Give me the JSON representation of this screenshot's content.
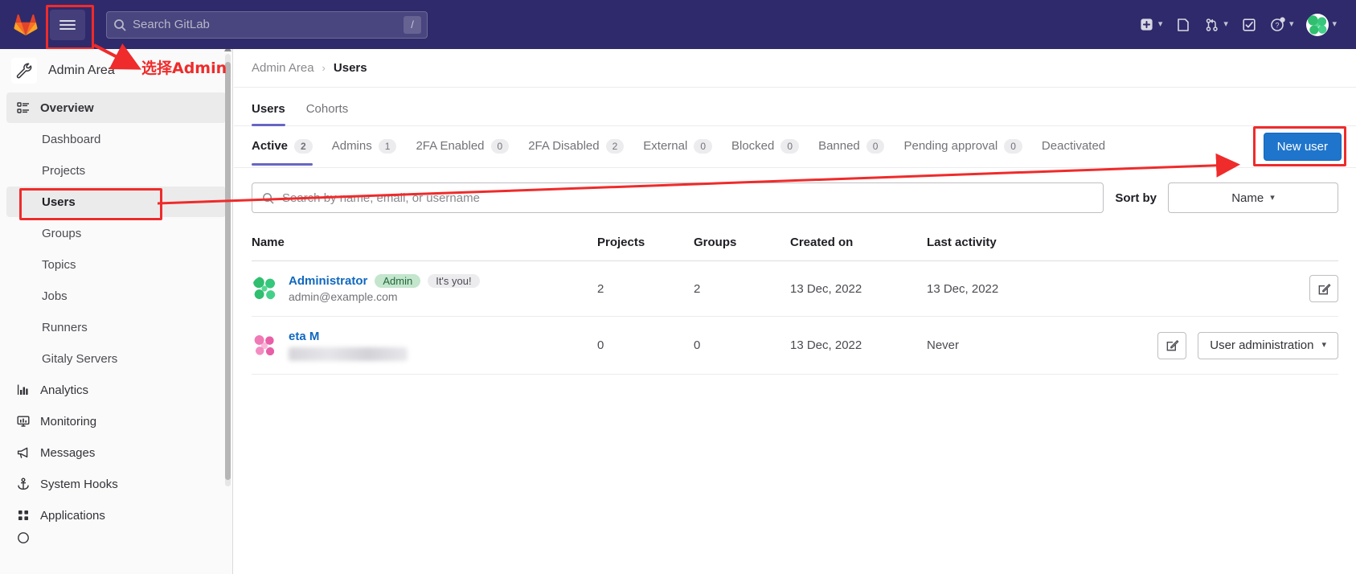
{
  "topnav": {
    "logo_icon": "gitlab-logo-icon",
    "hamburger_icon": "hamburger-menu-icon",
    "search": {
      "placeholder": "Search GitLab",
      "value": "",
      "shortcut_key": "/",
      "icon": "search-icon"
    },
    "items": [
      {
        "name": "create-new-menu",
        "icon": "plus-square-icon",
        "has_caret": true
      },
      {
        "name": "issues-menu",
        "icon": "issues-icon",
        "has_caret": false
      },
      {
        "name": "merge-requests-menu",
        "icon": "merge-request-icon",
        "has_caret": true
      },
      {
        "name": "todos-menu",
        "icon": "todo-check-icon",
        "has_caret": false
      },
      {
        "name": "help-menu",
        "icon": "question-circle-icon",
        "has_caret": true
      },
      {
        "name": "user-menu",
        "icon": "avatar",
        "has_caret": true
      }
    ]
  },
  "sidebar": {
    "header": {
      "title": "Admin Area",
      "icon": "wrench-icon"
    },
    "items": [
      {
        "label": "Overview",
        "icon": "overview-icon",
        "level": "top",
        "state": "active"
      },
      {
        "label": "Dashboard",
        "icon": "",
        "level": "sub",
        "state": ""
      },
      {
        "label": "Projects",
        "icon": "",
        "level": "sub",
        "state": ""
      },
      {
        "label": "Users",
        "icon": "",
        "level": "sub",
        "state": "selected"
      },
      {
        "label": "Groups",
        "icon": "",
        "level": "sub",
        "state": ""
      },
      {
        "label": "Topics",
        "icon": "",
        "level": "sub",
        "state": ""
      },
      {
        "label": "Jobs",
        "icon": "",
        "level": "sub",
        "state": ""
      },
      {
        "label": "Runners",
        "icon": "",
        "level": "sub",
        "state": ""
      },
      {
        "label": "Gitaly Servers",
        "icon": "",
        "level": "sub",
        "state": ""
      },
      {
        "label": "Analytics",
        "icon": "chart-icon",
        "level": "top",
        "state": ""
      },
      {
        "label": "Monitoring",
        "icon": "monitor-icon",
        "level": "top",
        "state": ""
      },
      {
        "label": "Messages",
        "icon": "megaphone-icon",
        "level": "top",
        "state": ""
      },
      {
        "label": "System Hooks",
        "icon": "anchor-icon",
        "level": "top",
        "state": ""
      },
      {
        "label": "Applications",
        "icon": "grid-apps-icon",
        "level": "top",
        "state": ""
      }
    ]
  },
  "breadcrumb": {
    "parent": "Admin Area",
    "separator": "›",
    "current": "Users"
  },
  "page_tabs": [
    {
      "label": "Users",
      "active": true
    },
    {
      "label": "Cohorts",
      "active": false
    }
  ],
  "filter_tabs": [
    {
      "label": "Active",
      "count": "2",
      "active": true
    },
    {
      "label": "Admins",
      "count": "1",
      "active": false
    },
    {
      "label": "2FA Enabled",
      "count": "0",
      "active": false
    },
    {
      "label": "2FA Disabled",
      "count": "2",
      "active": false
    },
    {
      "label": "External",
      "count": "0",
      "active": false
    },
    {
      "label": "Blocked",
      "count": "0",
      "active": false
    },
    {
      "label": "Banned",
      "count": "0",
      "active": false
    },
    {
      "label": "Pending approval",
      "count": "0",
      "active": false
    },
    {
      "label": "Deactivated",
      "count": "",
      "active": false
    }
  ],
  "new_user_button": {
    "label": "New user"
  },
  "search_row": {
    "search_placeholder": "Search by name, email, or username",
    "search_value": "",
    "search_icon": "search-icon",
    "sort_by_label": "Sort by",
    "sort_value": "Name"
  },
  "table": {
    "headers": [
      "Name",
      "Projects",
      "Groups",
      "Created on",
      "Last activity"
    ],
    "rows": [
      {
        "name": "Administrator",
        "email": "admin@example.com",
        "email_blurred": false,
        "badges": [
          "Admin",
          "It's you!"
        ],
        "projects": "2",
        "groups": "2",
        "created_on": "13 Dec, 2022",
        "last_activity": "13 Dec, 2022",
        "avatar": "admin-avatar",
        "edit_button": "edit-icon",
        "admin_button_label": ""
      },
      {
        "name": "eta M",
        "email": "",
        "email_blurred": true,
        "badges": [],
        "projects": "0",
        "groups": "0",
        "created_on": "13 Dec, 2022",
        "last_activity": "Never",
        "avatar": "eta-avatar",
        "edit_button": "edit-icon",
        "admin_button_label": "User administration"
      }
    ]
  },
  "annotations": {
    "admin_note": "选择Admin",
    "highlight_color": "#ef2b2b",
    "new_user_highlight_color": "#1f75cb"
  }
}
